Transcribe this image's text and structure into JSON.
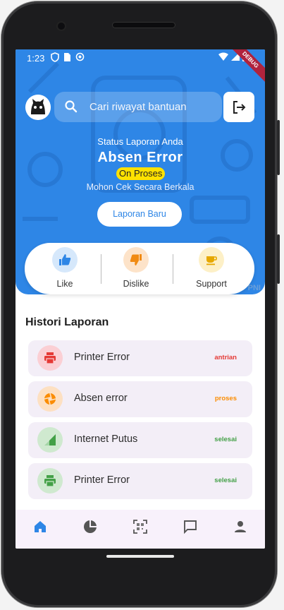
{
  "status_bar": {
    "time": "1:23",
    "debug_label": "DEBUG"
  },
  "search": {
    "placeholder": "Cari riwayat bantuan"
  },
  "report_status": {
    "label": "Status Laporan Anda",
    "title": "Absen Error",
    "badge": "On Proses",
    "note": "Mohon Cek Secara Berkala",
    "new_report_button": "Laporan Baru"
  },
  "watermark": "TALSPENT PNI",
  "reactions": [
    {
      "label": "Like",
      "icon": "thumb-up-icon"
    },
    {
      "label": "Dislike",
      "icon": "thumb-down-icon"
    },
    {
      "label": "Support",
      "icon": "coffee-icon"
    }
  ],
  "history": {
    "title": "Histori Laporan",
    "items": [
      {
        "title": "Printer Error",
        "status": "antrian",
        "status_color": "#e53935",
        "icon": "printer-icon"
      },
      {
        "title": "Absen error",
        "status": "proses",
        "status_color": "#fb8c00",
        "icon": "aperture-icon"
      },
      {
        "title": "Internet Putus",
        "status": "selesai",
        "status_color": "#43a047",
        "icon": "signal-icon"
      },
      {
        "title": "Printer Error",
        "status": "selesai",
        "status_color": "#43a047",
        "icon": "printer-icon"
      }
    ]
  },
  "bottom_nav": [
    "home-icon",
    "pie-chart-icon",
    "qr-scan-icon",
    "chat-icon",
    "person-icon"
  ],
  "colors": {
    "primary": "#2e86e6",
    "badge": "#ffe100"
  }
}
